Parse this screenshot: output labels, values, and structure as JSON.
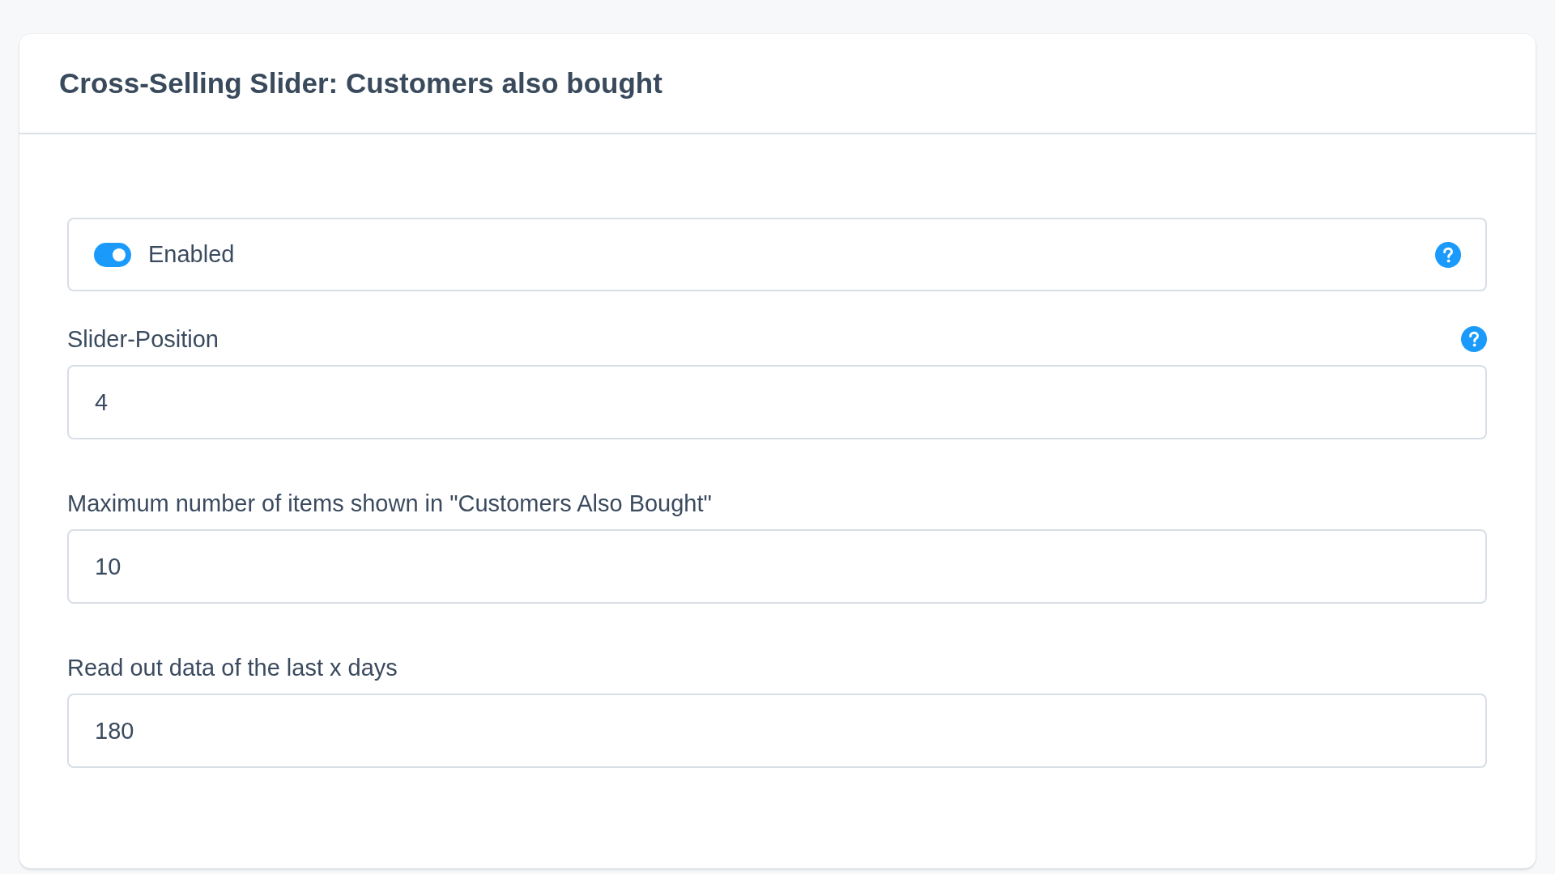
{
  "card": {
    "title": "Cross-Selling Slider: Customers also bought"
  },
  "toggle": {
    "label": "Enabled",
    "on": true,
    "help": true
  },
  "fields": [
    {
      "label": "Slider-Position",
      "value": "4",
      "help": true
    },
    {
      "label": "Maximum number of items shown in \"Customers Also Bought\"",
      "value": "10",
      "help": false
    },
    {
      "label": "Read out data of the last x days",
      "value": "180",
      "help": false
    }
  ]
}
